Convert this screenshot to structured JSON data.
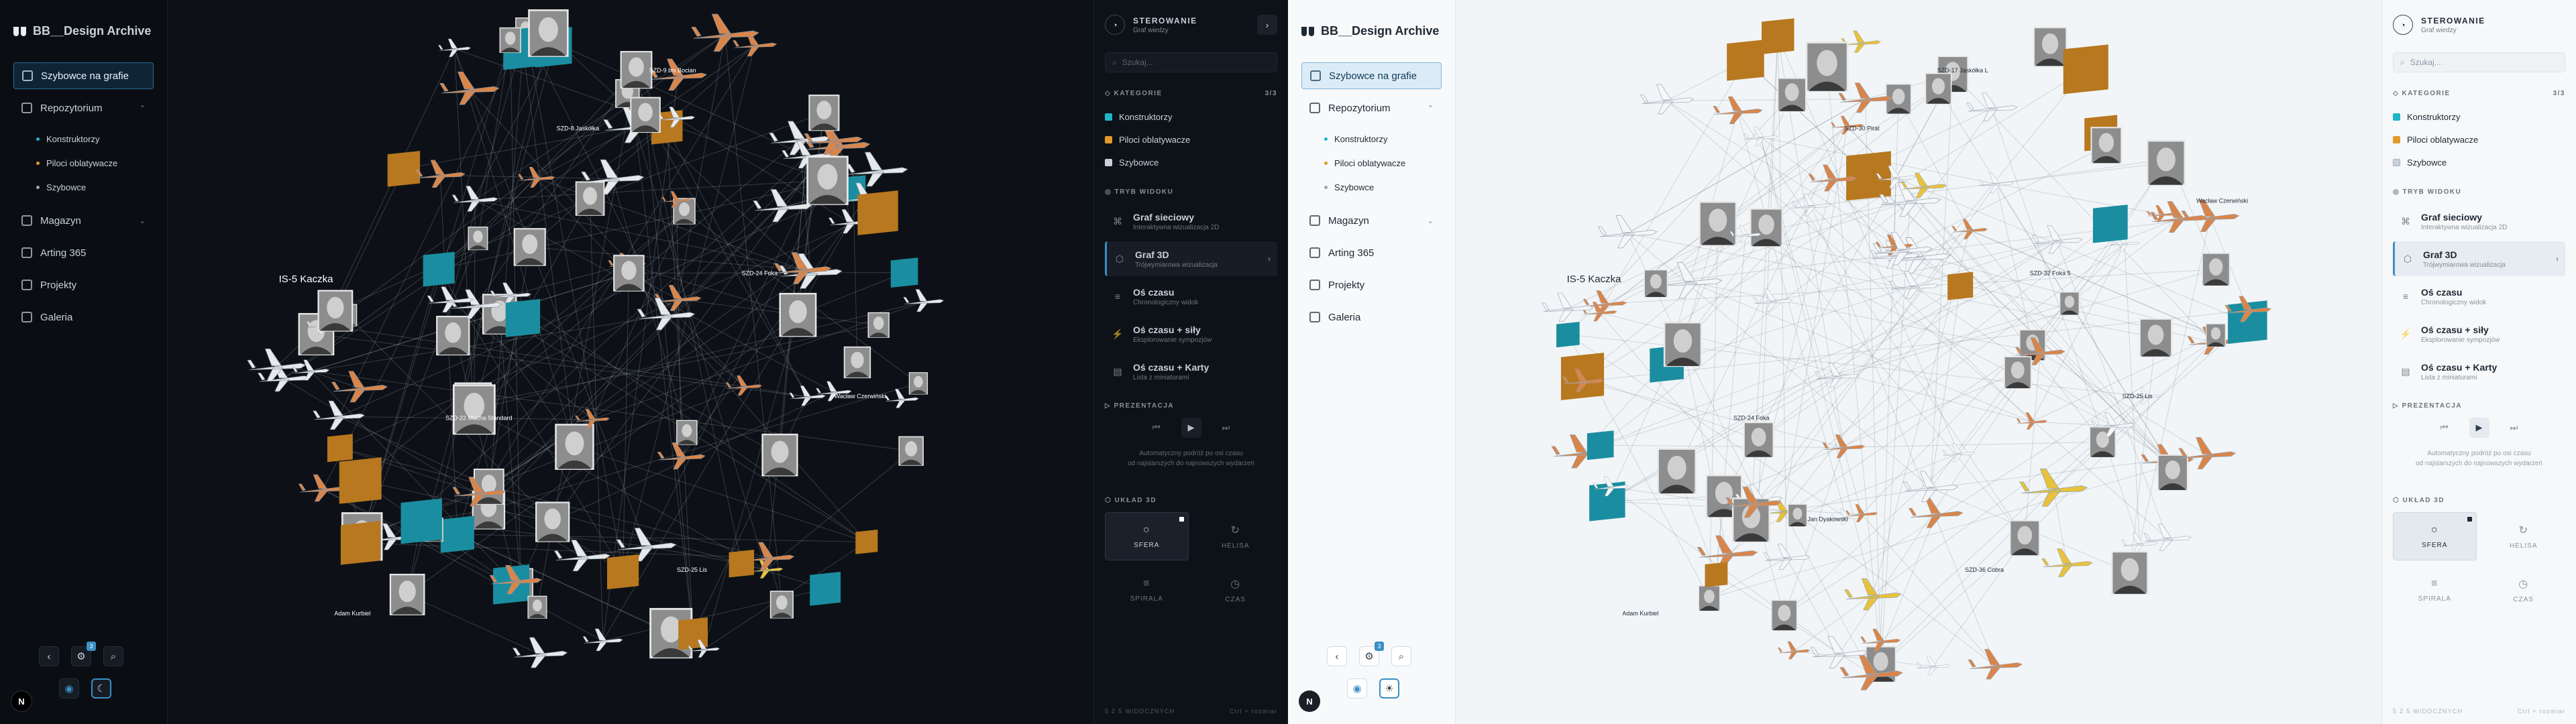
{
  "app": {
    "brand": "BB__Design Archive"
  },
  "sidebar": {
    "items": [
      {
        "label": "Szybowce na grafie",
        "icon": "network-icon",
        "active": true
      },
      {
        "label": "Repozytorium",
        "icon": "book-icon",
        "expanded": true,
        "children": [
          {
            "label": "Konstruktorzy",
            "color": "#1fb6c6"
          },
          {
            "label": "Piloci oblatywacze",
            "color": "#e09a2b"
          },
          {
            "label": "Szybowce",
            "color": "#9aa5b1"
          }
        ]
      },
      {
        "label": "Magazyn",
        "icon": "box-icon",
        "collapsible": true
      },
      {
        "label": "Arting 365",
        "icon": "palette-icon"
      },
      {
        "label": "Projekty",
        "icon": "folder-icon"
      },
      {
        "label": "Galeria",
        "icon": "gallery-icon"
      }
    ],
    "tools": {
      "back": "‹",
      "graph_badge": "3",
      "nav_letter": "N"
    }
  },
  "panel": {
    "header_title": "STEROWANIE",
    "header_subtitle": "Graf wiedzy",
    "search_placeholder": "Szukaj...",
    "categories_label": "KATEGORIE",
    "categories_count": "3/3",
    "categories": [
      {
        "label": "Konstruktorzy",
        "color": "#1fb6c6"
      },
      {
        "label": "Piloci oblatywacze",
        "color": "#e09a2b"
      },
      {
        "label": "Szybowce",
        "color": "#c9d1d9"
      }
    ],
    "view_mode_label": "TRYB WIDOKU",
    "views": [
      {
        "title": "Graf sieciowy",
        "desc": "Interaktywna wizualizacja 2D",
        "icon": "network-icon"
      },
      {
        "title": "Graf 3D",
        "desc": "Trójwymiarowa wizualizacja",
        "icon": "cube-icon",
        "active": true
      },
      {
        "title": "Oś czasu",
        "desc": "Chronologiczny widok",
        "icon": "timeline-icon"
      },
      {
        "title": "Oś czasu + siły",
        "desc": "Eksplorowanie sympozjów",
        "icon": "force-icon"
      },
      {
        "title": "Oś czasu + Karty",
        "desc": "Lista z miniaturami",
        "icon": "cards-icon"
      }
    ],
    "presentation_label": "PREZENTACJA",
    "presentation_hint_1": "Automatyczny podróż po osi czasu",
    "presentation_hint_2": "od najstarszych do najnowszych wydarzeń",
    "layout_label": "UKŁAD 3D",
    "layouts": [
      {
        "label": "SFERA",
        "icon": "circle-icon",
        "active": true
      },
      {
        "label": "HELISA",
        "icon": "helix-icon"
      },
      {
        "label": "SPIRALA",
        "icon": "spiral-icon"
      },
      {
        "label": "CZAS",
        "icon": "clock-icon"
      }
    ],
    "footer_left": "5 Z 5 WIDOCZNYCH",
    "footer_right": "Ctrl + rozmiar"
  },
  "graph_dark": {
    "labels": [
      "IS-5 Kaczka",
      "SZD-9 bis Bocian",
      "SZD-8 Jaskółka",
      "SZD-24 Foka",
      "SZD-22 Mucha Standard",
      "SZD-25 Lis",
      "Wacław Czerwiński",
      "Adam Kurbiel"
    ]
  },
  "graph_light": {
    "labels": [
      "IS-5 Kaczka",
      "SZD-17 Jaskółka L",
      "SZD-30 Pirat",
      "SZD-32 Foka 5",
      "SZD-24 Foka",
      "SZD-36 Cobra",
      "SZD-25 Lis",
      "Adam Kurbiel",
      "Wacław Czerwiński",
      "Jan Dyakowski"
    ]
  },
  "colors": {
    "accent": "#3b8fc4",
    "constructor": "#1fb6c6",
    "pilot": "#e09a2b",
    "glider": "#c9d1d9"
  }
}
